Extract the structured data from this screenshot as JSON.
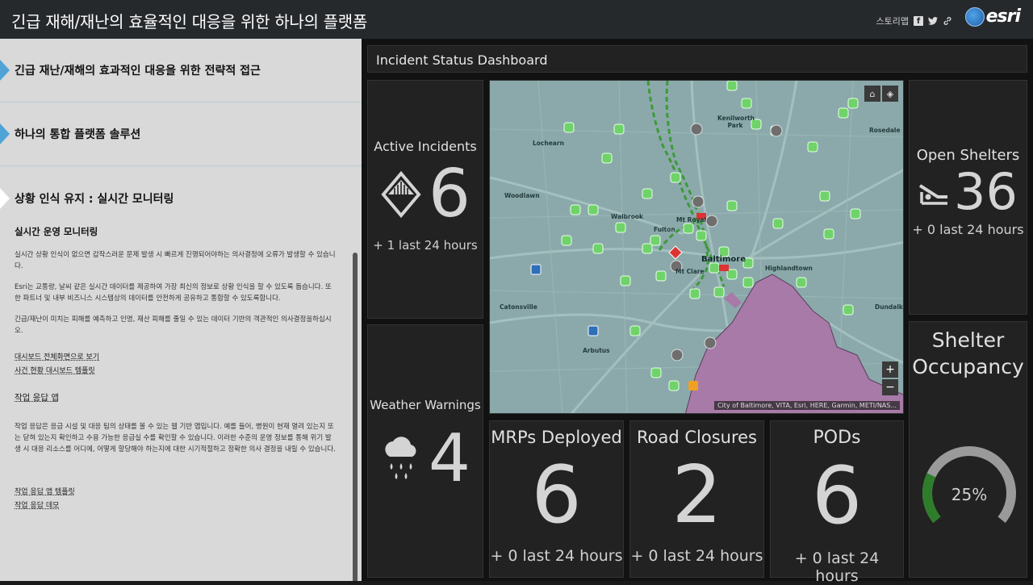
{
  "header": {
    "title": "긴급 재해/재난의 효율적인 대응을 위한 하나의 플랫폼",
    "story_map_label": "스토리맵",
    "brand": "esri"
  },
  "sidebar": {
    "sections": [
      {
        "label": "긴급 재난/재해의 효과적인 대응을 위한 전략적 접근",
        "active": false
      },
      {
        "label": "하나의 통합 플랫폼 솔루션",
        "active": false
      },
      {
        "label": "상황 인식 유지 : 실시간 모니터링",
        "active": true
      }
    ],
    "content": {
      "heading": "실시간 운영 모니터링",
      "paragraphs": [
        "실시간 상황 인식이 없으면 갑작스러운 문제 발생 시 빠르게 진행되어야하는 의사결정에 오류가 발생할 수 있습니다.",
        "Esri는 교통량, 날씨 같은 실시간 데이터를 제공하여 가장 최신의 정보로 상황 인식을 할 수 있도록 돕습니다. 또한 파트너 및 내부 비즈니스 시스템상의 데이터를 안전하게 공유하고 통합할 수 있도록합니다.",
        "긴급/재난이 미치는 피해를 예측하고 인명, 재산 피해를 줄일 수 있는 데이터 기반의 객관적인 의사결정을하십시오."
      ],
      "links": [
        "대시보드 전체화면으로 보기",
        "사건 현황 대시보드 템플릿"
      ],
      "subheading": "작업 응답 앱",
      "app_paragraph": "작업 응답은 응급 시설 및 대응 팀의 상태를 볼 수 있는 웹 기반 앱입니다. 예를 들어, 병원이 현재 열려 있는지 또는 닫혀 있는지 확인하고 수용 가능한 응급실 수를 확인할 수 있습니다. 이러한 수준의 운영 정보를 통해 위기 발생 시 대응 리소스를 어디에, 어떻게 할당해야 하는지에 대한 시기적절하고 정확한 의사 결정을 내릴 수 있습니다.",
      "app_links": [
        "작업 응답 앱 템플릿",
        "작업 응답 데모"
      ]
    }
  },
  "dashboard": {
    "title": "Incident Status Dashboard",
    "active_incidents": {
      "title": "Active Incidents",
      "value": "6",
      "sub": "+ 1 last 24 hours"
    },
    "weather_warnings": {
      "title": "Weather Warnings",
      "value": "4"
    },
    "open_shelters": {
      "title": "Open Shelters",
      "value": "36",
      "sub": "+ 0 last 24 hours"
    },
    "shelter_occupancy": {
      "title_line1": "Shelter",
      "title_line2": "Occupancy",
      "value_label": "25%",
      "value": 0.25
    },
    "mrps_deployed": {
      "title": "MRPs Deployed",
      "value": "6",
      "sub": "+ 0 last 24 hours"
    },
    "road_closures": {
      "title": "Road Closures",
      "value": "2",
      "sub": "+ 0 last 24 hours"
    },
    "pods": {
      "title": "PODs",
      "value": "6",
      "sub": "+ 0 last 24 hours"
    },
    "map": {
      "attribution": "City of Baltimore, VITA, Esri, HERE, Garmin, METI/NAS...",
      "city": "Baltimore",
      "labels": [
        "Lochearn",
        "Woodlawn",
        "Catonsville",
        "Arbutus",
        "Kenilworth Park",
        "Rosedale",
        "Highlandtown",
        "Dundalk",
        "Walbrook",
        "Mt Royal",
        "Fulton",
        "Mt Clare"
      ]
    }
  },
  "colors": {
    "accent": "#4fa3d6",
    "gauge_fill": "#2e7d2a",
    "gauge_track": "#9a9a9a",
    "shelter_icon": "#6fd36a",
    "flood_area": "#a87aa8"
  }
}
